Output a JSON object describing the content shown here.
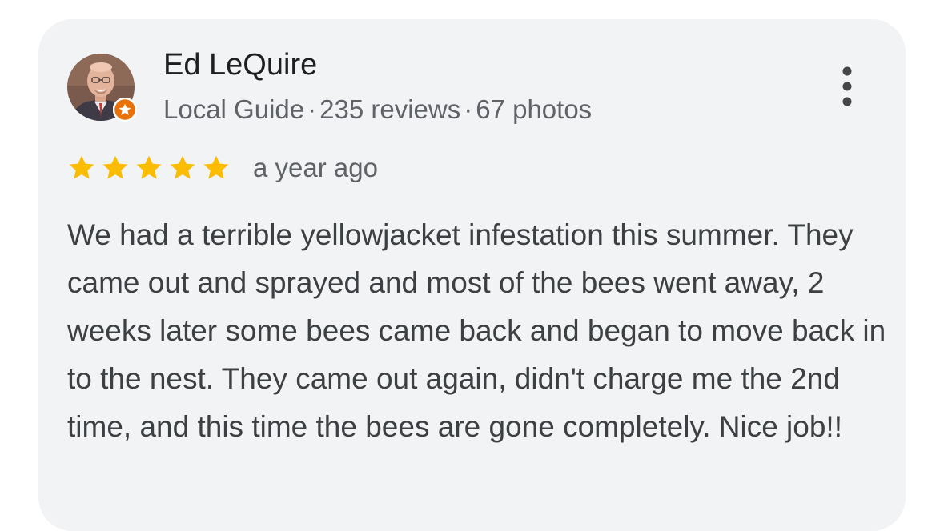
{
  "review": {
    "reviewer_name": "Ed LeQuire",
    "badge_label": "Local Guide",
    "separator": "·",
    "reviews_count": "235 reviews",
    "photos_count": "67 photos",
    "rating": 5,
    "rating_max": 5,
    "time_ago": "a year ago",
    "text": "We had a terrible yellowjacket infestation this summer. They came out and sprayed and most of the bees went away, 2 weeks later some bees came back and began to move back in to the nest. They came out again, didn't charge me the 2nd time, and this time the bees are gone completely. Nice job!!"
  },
  "icons": {
    "avatar": "reviewer-avatar-photo",
    "badge": "local-guide-badge-icon",
    "more": "more-vert-icon",
    "star": "star-icon"
  },
  "colors": {
    "card_background": "#f2f3f5",
    "star": "#fbbc04",
    "badge": "#e8710a",
    "name": "#1f1f1f",
    "meta": "#5f6368",
    "body_text": "#3c4043"
  }
}
